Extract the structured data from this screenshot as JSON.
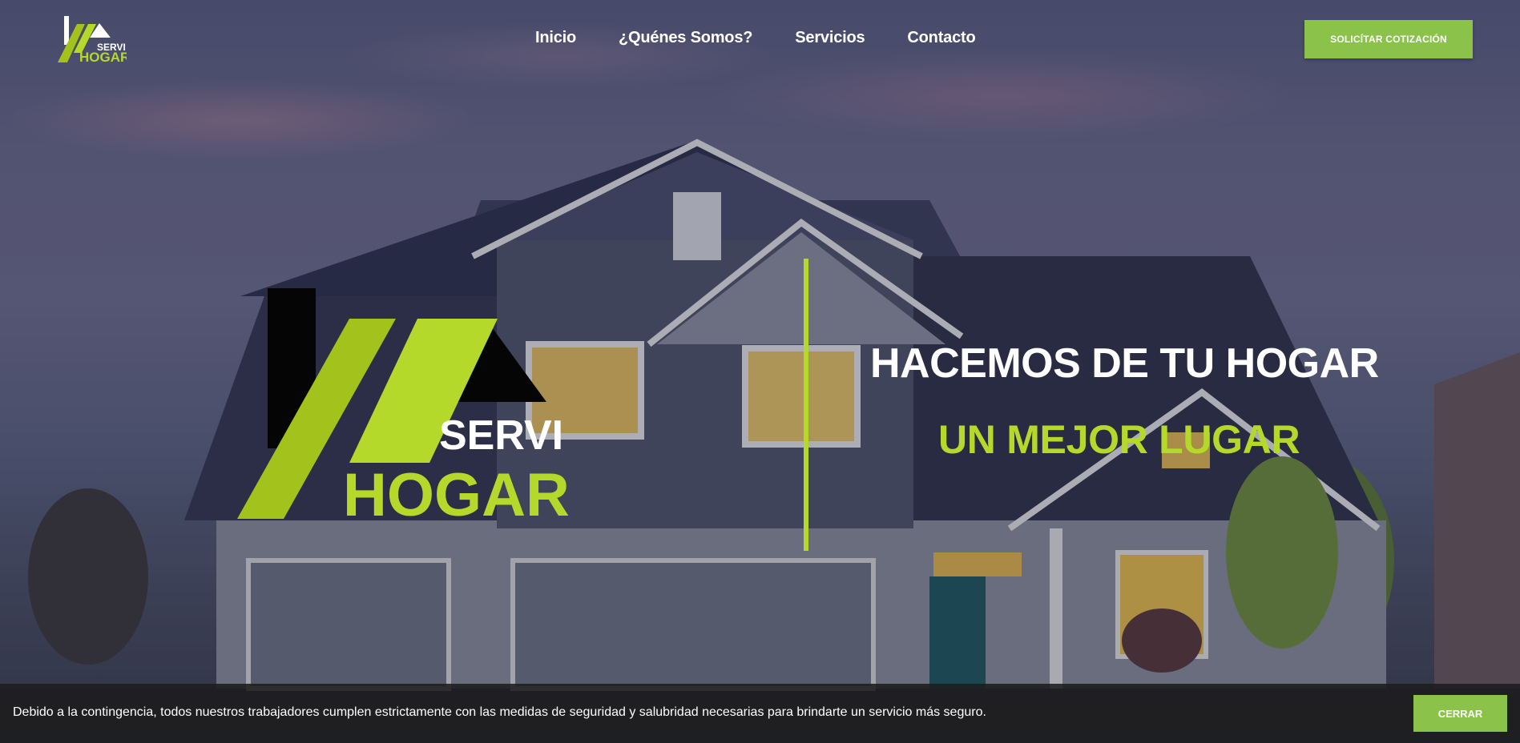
{
  "header": {
    "logo": {
      "line1": "SERVI",
      "line2": "HOGAR"
    },
    "nav": [
      {
        "label": "Inicio"
      },
      {
        "label": "¿Quénes Somos?"
      },
      {
        "label": "Servicios"
      },
      {
        "label": "Contacto"
      }
    ],
    "cta_label": "SOLICÍTAR COTIZACIÓN"
  },
  "hero": {
    "logo": {
      "line1": "SERVI",
      "line2": "HOGAR"
    },
    "headline": "HACEMOS DE TU HOGAR",
    "subheadline": "UN MEJOR LUGAR"
  },
  "notice": {
    "text": "Debido a la contingencia, todos nuestros trabajadores cumplen estrictamente con las medidas de seguridad y salubridad necesarias para brindarte un servicio más seguro.",
    "close_label": "CERRAR"
  },
  "colors": {
    "accent_green": "#8bc34a",
    "lime": "#b5d92a",
    "lime_dark": "#a4c21c",
    "white": "#ffffff"
  }
}
